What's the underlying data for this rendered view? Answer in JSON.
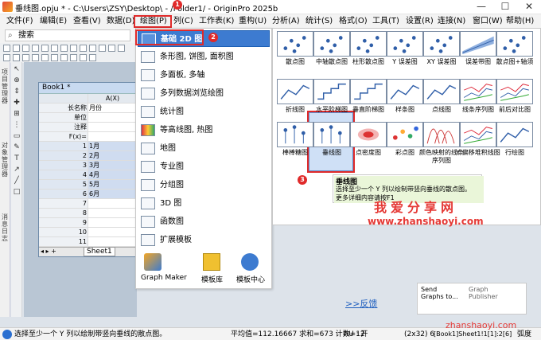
{
  "window": {
    "title": "垂线图.opju * - C:\\Users\\ZSY\\Desktop\\ - /Folder1/ - OriginPro 2025b"
  },
  "menubar": [
    "文件(F)",
    "编辑(E)",
    "查看(V)",
    "数据(D)",
    "绘图(P)",
    "列(C)",
    "工作表(K)",
    "重构(U)",
    "分析(A)",
    "统计(S)",
    "格式(O)",
    "工具(T)",
    "设置(R)",
    "连接(N)",
    "窗口(W)",
    "帮助(H)"
  ],
  "search": {
    "placeholder": "搜索"
  },
  "left_panel_text": [
    "项目管理器",
    "对象管理器",
    "消息日志"
  ],
  "book": {
    "title": "Book1 *",
    "col_a": "A(X)",
    "row_labels": [
      "长名称",
      "单位",
      "注释",
      "F(x)="
    ],
    "long_name_a": "月份",
    "rows": [
      "1",
      "2",
      "3",
      "4",
      "5",
      "6",
      "7",
      "8",
      "9",
      "10",
      "11",
      "12",
      "13"
    ],
    "values_a": [
      "1月",
      "2月",
      "3月",
      "4月",
      "5月",
      "6月"
    ],
    "sheet_tab": "Sheet1"
  },
  "dropdown": [
    "基础 2D 图",
    "条形图, 饼图, 面积图",
    "多面板, 多轴",
    "多列数据浏览绘图",
    "统计图",
    "等高线图, 热图",
    "地图",
    "专业图",
    "分组图",
    "3D 图",
    "函数图",
    "扩展模板"
  ],
  "dropdown_bottom": [
    "Graph Maker",
    "模板库",
    "模板中心"
  ],
  "gallery": {
    "row1": [
      "散点图",
      "中轴散点图",
      "柱形散点图",
      "Y 误差图",
      "XY 误差图",
      "误差带图",
      "散点图+轴须"
    ],
    "row2": [
      "折线图",
      "水平阶梯图",
      "垂直阶梯图",
      "样条图",
      "点线图",
      "线条序列图",
      "前后对比图"
    ],
    "row3": [
      "棒棒糖图",
      "垂线图",
      "点密度图",
      "彩点图",
      "颜色映射的线条序列图",
      "Y 偏移堆积线图",
      "行绘图"
    ]
  },
  "tooltip": {
    "title": "垂线图",
    "line1": "选择至少一个 Y 列以绘制带竖向垂线的散点图。",
    "line2": "更多详细内容请按F1"
  },
  "badges": [
    "1",
    "2",
    "3"
  ],
  "lower": {
    "feedback": ">>反馈",
    "send_graphs": "Send Graphs to...",
    "publisher": "Graph Publisher"
  },
  "status": {
    "left": "选择至少一个 Y 列以绘制带竖向垂线的散点图。",
    "mid": "平均值=112.16667 求和=673 计数=12",
    "au": "AU : 开",
    "dim": "(2x32) 6",
    "ref": "[Book1]Sheet1!1[1]:2[6]",
    "unit": "弧度"
  },
  "watermark": {
    "title": "我爱分享网",
    "url": "www.zhanshaoyi.com",
    "corner": "zhanshaoyi.com"
  },
  "colors": {
    "accent": "#3d7bd0",
    "highlight": "#e02a2a",
    "tooltip_bg": "#eaf6d9"
  }
}
